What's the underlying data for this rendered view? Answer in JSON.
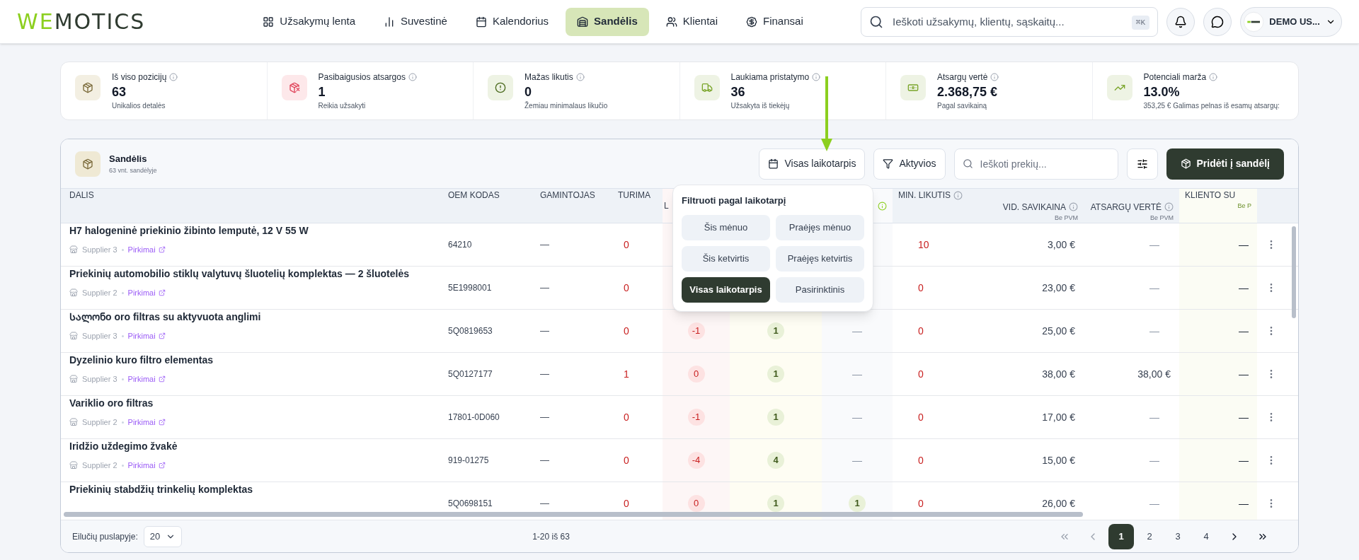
{
  "header": {
    "logo": {
      "accent": "WE",
      "rest": "MOTICS"
    },
    "nav": [
      {
        "label": "Užsakymų lenta",
        "selected": false
      },
      {
        "label": "Suvestinė",
        "selected": false
      },
      {
        "label": "Kalendorius",
        "selected": false
      },
      {
        "label": "Sandėlis",
        "selected": true
      },
      {
        "label": "Klientai",
        "selected": false
      },
      {
        "label": "Finansai",
        "selected": false
      }
    ],
    "search": {
      "placeholder": "Ieškoti užsakymų, klientų, sąskaitų...",
      "shortcut": "⌘K"
    },
    "user": {
      "name": "DEMO US..."
    }
  },
  "stats": [
    {
      "label": "Iš viso pozicijų",
      "value": "63",
      "sub": "Unikalios detalės",
      "color": "#f3efe2"
    },
    {
      "label": "Pasibaigusios atsargos",
      "value": "1",
      "sub": "Reikia užsakyti",
      "color": "#fde8ea"
    },
    {
      "label": "Mažas likutis",
      "value": "0",
      "sub": "Žemiau minimalaus likučio",
      "color": "#eef3e4"
    },
    {
      "label": "Laukiama pristatymo",
      "value": "36",
      "sub": "Užsakyta iš tiekėjų",
      "color": "#eef3e4"
    },
    {
      "label": "Atsargų vertė",
      "value": "2.368,75 €",
      "sub": "Pagal savikainą",
      "color": "#eef3e4"
    },
    {
      "label": "Potenciali marža",
      "value": "13.0%",
      "sub": "353,25 € Galimas pelnas iš esamų atsargų:",
      "color": "#eef3e4"
    }
  ],
  "panel": {
    "title": "Sandėlis",
    "subtitle": "63 vnt. sandėlyje",
    "period_button": "Visas laikotarpis",
    "filter_button": "Aktyvios",
    "search_placeholder": "Ieškoti prekių...",
    "add_button": "Pridėti į sandėlį",
    "period_menu": {
      "title": "Filtruoti pagal laikotarpį",
      "options": [
        {
          "label": "Šis mėnuo",
          "selected": false
        },
        {
          "label": "Praėjęs mėnuo",
          "selected": false
        },
        {
          "label": "Šis ketvirtis",
          "selected": false
        },
        {
          "label": "Praėjęs ketvirtis",
          "selected": false
        },
        {
          "label": "Visas laikotarpis",
          "selected": true
        },
        {
          "label": "Pasirinktinis",
          "selected": false
        }
      ]
    },
    "columns": [
      {
        "label": "DALIS"
      },
      {
        "label": "OEM KODAS"
      },
      {
        "label": "GAMINTOJAS"
      },
      {
        "label": "TURIMA"
      },
      {
        "label": "L"
      },
      {},
      {
        "info": true
      },
      {
        "label": "MIN. LIKUTIS",
        "info": true
      },
      {
        "label": "VID. SAVIKAINA",
        "info": true,
        "sub": "Be PVM"
      },
      {
        "label": "ATSARGŲ VERTĖ",
        "info": true,
        "sub": "Be PVM"
      },
      {
        "label": "KLIENTO SU",
        "sub": "Be P"
      }
    ],
    "rows": [
      {
        "name": "H7 halogeninė priekinio žibinto lemputė, 12 V 55 W",
        "supplier": "Supplier 3",
        "link": "Pirkimai",
        "oem": "64210",
        "maker": "—",
        "stock": "0",
        "min": "10",
        "avg_cost": "3,00 €",
        "stock_value": {
          "text": "—",
          "muted": true
        },
        "client": "—"
      },
      {
        "name": "Priekinių automobilio stiklų valytuvų šluotelių komplektas — 2 šluotelės",
        "supplier": "Supplier 2",
        "link": "Pirkimai",
        "oem": "5E1998001",
        "maker": "—",
        "stock": "0",
        "min": "0",
        "avg_cost": "23,00 €",
        "stock_value": {
          "text": "—",
          "muted": true
        },
        "client": "—"
      },
      {
        "name": "Სალონo oro filtras su aktyvuota anglimi",
        "supplier": "Supplier 3",
        "link": "Pirkimai",
        "oem": "5Q0819653",
        "maker": "—",
        "stock": "0",
        "col_5": "-1",
        "col_6": "1",
        "col_7": {
          "kind": "dash",
          "text": "—"
        },
        "min": "0",
        "avg_cost": "25,00 €",
        "stock_value": {
          "text": "—",
          "muted": true
        },
        "client": "—"
      },
      {
        "name": "Dyzelinio kuro filtro elementas",
        "supplier": "Supplier 3",
        "link": "Pirkimai",
        "oem": "5Q0127177",
        "maker": "—",
        "stock": "1",
        "col_5": "0",
        "col_6": "1",
        "col_7": {
          "kind": "dash",
          "text": "—"
        },
        "min": "0",
        "avg_cost": "38,00 €",
        "stock_value": {
          "text": "38,00 €",
          "muted": false
        },
        "client": "—"
      },
      {
        "name": "Variklio oro filtras",
        "supplier": "Supplier 2",
        "link": "Pirkimai",
        "oem": "17801-0D060",
        "maker": "—",
        "stock": "0",
        "col_5": "-1",
        "col_6": "1",
        "col_7": {
          "kind": "dash",
          "text": "—"
        },
        "min": "0",
        "avg_cost": "17,00 €",
        "stock_value": {
          "text": "—",
          "muted": true
        },
        "client": "—"
      },
      {
        "name": "Iridžio uždegimo žvakė",
        "supplier": "Supplier 2",
        "link": "Pirkimai",
        "oem": "919-01275",
        "maker": "—",
        "stock": "0",
        "col_5": "-4",
        "col_6": "4",
        "col_7": {
          "kind": "dash",
          "text": "—"
        },
        "min": "0",
        "avg_cost": "15,00 €",
        "stock_value": {
          "text": "—",
          "muted": true
        },
        "client": "—"
      },
      {
        "name": "Priekinių stabdžių trinkelių komplektas",
        "oem": "5Q0698151",
        "maker": "—",
        "stock": "0",
        "col_5": "0",
        "col_6": "1",
        "col_7": {
          "kind": "pill",
          "text": "1"
        },
        "min": "0",
        "avg_cost": "26,00 €",
        "stock_value": {
          "text": "—",
          "muted": true
        },
        "client": "—"
      }
    ],
    "footer": {
      "rows_label": "Eilučių puslapyje:",
      "rows_value": "20",
      "range": "1-20 iš 63",
      "pages": [
        {
          "label": "1",
          "selected": true
        },
        {
          "label": "2",
          "selected": false
        },
        {
          "label": "3",
          "selected": false
        },
        {
          "label": "4",
          "selected": false
        }
      ]
    }
  }
}
